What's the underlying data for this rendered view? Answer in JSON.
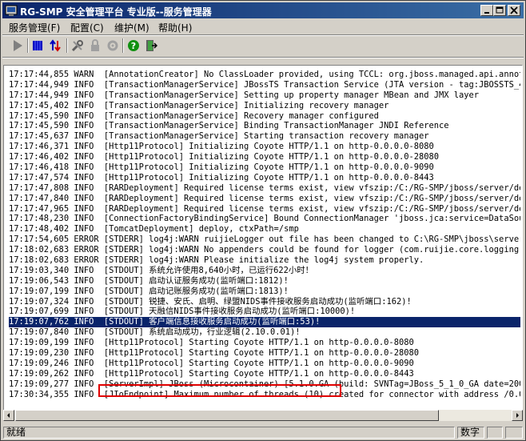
{
  "window": {
    "title": "RG-SMP 安全管理平台 专业版--服务管理器"
  },
  "menu": [
    {
      "label": "服务管理(F)"
    },
    {
      "label": "配置(C)"
    },
    {
      "label": "维护(M)"
    },
    {
      "label": "帮助(H)"
    }
  ],
  "toolbar": {
    "icons": [
      "start-icon",
      "stop-icon",
      "restart-icon",
      "tools-icon",
      "lock-icon",
      "settings-icon",
      "help-icon",
      "exit-icon"
    ]
  },
  "log": {
    "lines": [
      "17:17:44,855 WARN  [AnnotationCreator] No ClassLoader provided, using TCCL: org.jboss.managed.api.annotation.",
      "17:17:44,949 INFO  [TransactionManagerService] JBossTS Transaction Service (JTA version - tag:JBOSSTS_4_6",
      "17:17:44,949 INFO  [TransactionManagerService] Setting up property manager MBean and JMX layer",
      "17:17:45,402 INFO  [TransactionManagerService] Initializing recovery manager",
      "17:17:45,590 INFO  [TransactionManagerService] Recovery manager configured",
      "17:17:45,590 INFO  [TransactionManagerService] Binding TransactionManager JNDI Reference",
      "17:17:45,637 INFO  [TransactionManagerService] Starting transaction recovery manager",
      "17:17:46,371 INFO  [Http11Protocol] Initializing Coyote HTTP/1.1 on http-0.0.0.0-8080",
      "17:17:46,402 INFO  [Http11Protocol] Initializing Coyote HTTP/1.1 on http-0.0.0.0-28080",
      "17:17:46,418 INFO  [Http11Protocol] Initializing Coyote HTTP/1.1 on http-0.0.0.0-9090",
      "17:17:47,574 INFO  [Http11Protocol] Initializing Coyote HTTP/1.1 on http-0.0.0.0-8443",
      "17:17:47,808 INFO  [RARDeployment] Required license terms exist, view vfszip:/C:/RG-SMP/jboss/server/def",
      "17:17:47,840 INFO  [RARDeployment] Required license terms exist, view vfszip:/C:/RG-SMP/jboss/server/def",
      "17:17:47,965 INFO  [RARDeployment] Required license terms exist, view vfszip:/C:/RG-SMP/jboss/server/def",
      "17:17:48,230 INFO  [ConnectionFactoryBindingService] Bound ConnectionManager 'jboss.jca:service=DataSour",
      "17:17:48,402 INFO  [TomcatDeployment] deploy, ctxPath=/smp",
      "17:17:54,605 ERROR [STDERR] log4j:WARN ruijieLogger out file has been changed to C:\\RG-SMP\\jboss\\server\\",
      "17:18:02,683 ERROR [STDERR] log4j:WARN No appenders could be found for logger (com.ruijie.core.logging.s",
      "17:18:02,683 ERROR [STDERR] log4j:WARN Please initialize the log4j system properly.",
      "17:19:03,340 INFO  [STDOUT] 系统允许使用8,640小时，已运行622小时！",
      "17:19:06,543 INFO  [STDOUT] 启动认证服务成功(监听端口:1812)!",
      "17:19:07,199 INFO  [STDOUT] 启动记账服务成功(监听端口:1813)!",
      "17:19:07,324 INFO  [STDOUT] 锐捷、安氏、启明、绿盟NIDS事件接收服务启动成功(监听端口:162)!",
      "17:19:07,699 INFO  [STDOUT] 天融信NIDS事件接收服务启动成功(监听端口:10000)!",
      "17:19:07,762 INFO  [STDOUT] 客户端信息接收服务启动成功(监听端口:53)!",
      "17:19:07,840 INFO  [STDOUT] 系统启动成功，行业逻辑(2.10.0.01)!",
      "17:19:09,199 INFO  [Http11Protocol] Starting Coyote HTTP/1.1 on http-0.0.0.0-8080",
      "17:19:09,230 INFO  [Http11Protocol] Starting Coyote HTTP/1.1 on http-0.0.0.0-28080",
      "17:19:09,246 INFO  [Http11Protocol] Starting Coyote HTTP/1.1 on http-0.0.0.0-9090",
      "17:19:09,262 INFO  [Http11Protocol] Starting Coyote HTTP/1.1 on http-0.0.0.0-8443",
      "17:19:09,277 INFO  [ServerImpl] JBoss (Microcontainer) [5.1.0.GA (build: SVNTag=JBoss_5_1_0_GA date=20090",
      "17:30:34,355 INFO  [JIoEndpoint] Maximum number of threads (10) created for connector with address /0.0.0"
    ],
    "selected_index": 24
  },
  "status": {
    "text": "就绪",
    "num_indicator": "数字"
  }
}
